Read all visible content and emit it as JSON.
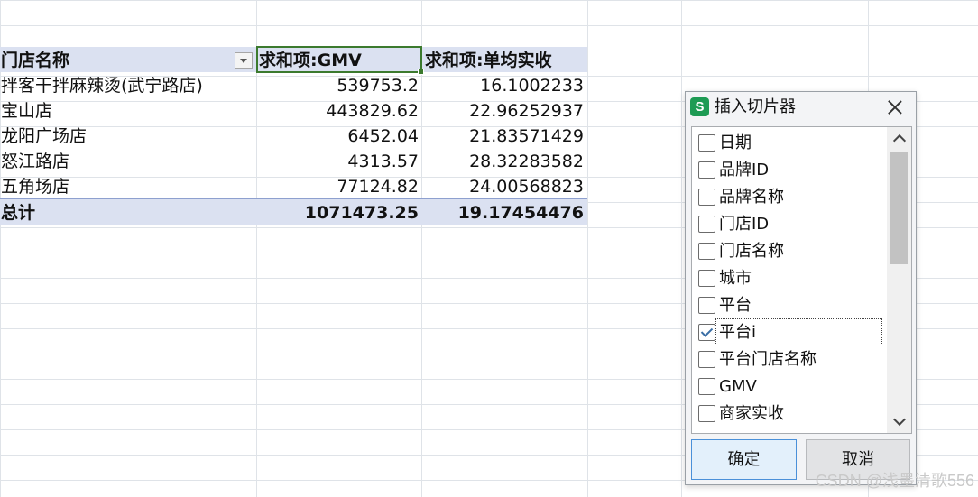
{
  "pivot": {
    "header": {
      "store_name": "门店名称",
      "gmv_sum": "求和项:GMV",
      "avg_receipt_sum": "求和项:单均实收"
    },
    "rows": [
      {
        "store": "拌客干拌麻辣烫(武宁路店)",
        "gmv": "539753.2",
        "avg": "16.1002233"
      },
      {
        "store": "宝山店",
        "gmv": "443829.62",
        "avg": "22.96252937"
      },
      {
        "store": "龙阳广场店",
        "gmv": "6452.04",
        "avg": "21.83571429"
      },
      {
        "store": "怒江路店",
        "gmv": "4313.57",
        "avg": "28.32283582"
      },
      {
        "store": "五角场店",
        "gmv": "77124.82",
        "avg": "24.00568823"
      }
    ],
    "total": {
      "label": "总计",
      "gmv": "1071473.25",
      "avg": "19.17454476"
    }
  },
  "dialog": {
    "app_icon": "S",
    "title": "插入切片器",
    "items": [
      {
        "label": "日期",
        "checked": false
      },
      {
        "label": "品牌ID",
        "checked": false
      },
      {
        "label": "品牌名称",
        "checked": false
      },
      {
        "label": "门店ID",
        "checked": false
      },
      {
        "label": "门店名称",
        "checked": false
      },
      {
        "label": "城市",
        "checked": false
      },
      {
        "label": "平台",
        "checked": false
      },
      {
        "label": "平台i",
        "checked": true
      },
      {
        "label": "平台门店名称",
        "checked": false
      },
      {
        "label": "GMV",
        "checked": false
      },
      {
        "label": "商家实收",
        "checked": false
      }
    ],
    "ok_label": "确定",
    "cancel_label": "取消"
  },
  "watermark": "CSDN @浅墨清歌556",
  "colors": {
    "pivot_header_bg": "#dbe1f1",
    "active_cell_border": "#3c7a2e",
    "app_icon_bg": "#1e9b54",
    "ok_button_bg": "#e3f0fb"
  }
}
